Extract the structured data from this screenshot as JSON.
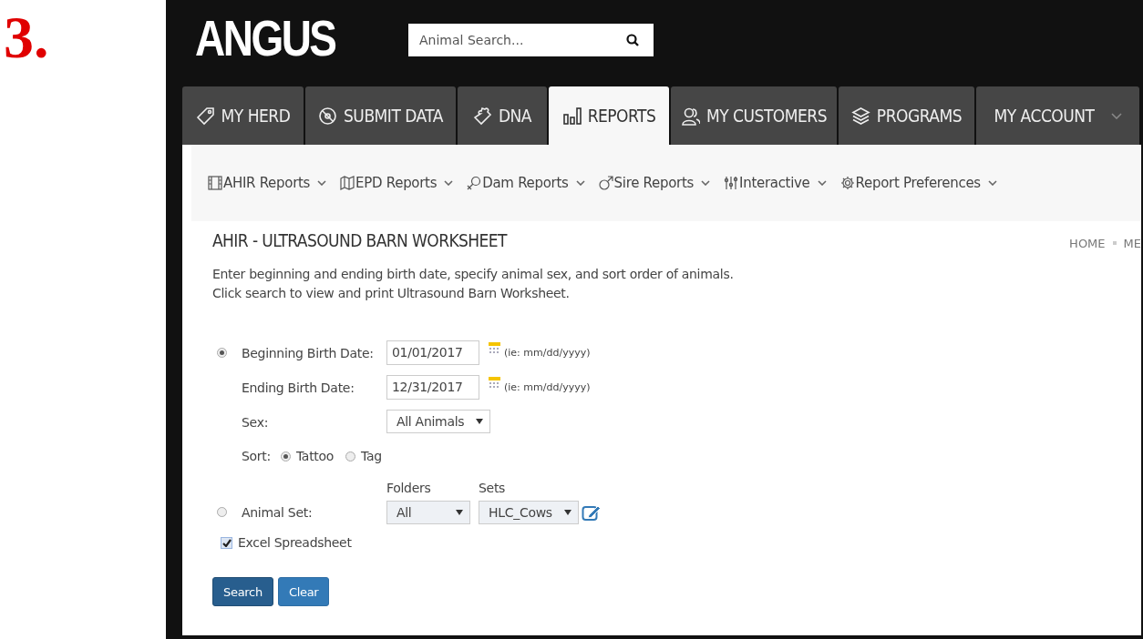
{
  "step_label": "3.",
  "header": {
    "logo": "ANGUS",
    "search": {
      "placeholder": "Animal Search..."
    }
  },
  "tabs": [
    {
      "label": "MY HERD",
      "kind": "link",
      "selected": false
    },
    {
      "label": "SUBMIT DATA",
      "kind": "link",
      "selected": false
    },
    {
      "label": "DNA",
      "kind": "link",
      "selected": false
    },
    {
      "label": "REPORTS",
      "kind": "link",
      "selected": true
    },
    {
      "label": "MY CUSTOMERS",
      "kind": "link",
      "selected": false
    },
    {
      "label": "PROGRAMS",
      "kind": "link",
      "selected": false
    },
    {
      "label": "MY ACCOUNT",
      "kind": "dropdown",
      "selected": false
    }
  ],
  "subnav": [
    {
      "label": "AHIR Reports"
    },
    {
      "label": "EPD Reports"
    },
    {
      "label": "Dam Reports"
    },
    {
      "label": "Sire Reports"
    },
    {
      "label": "Interactive"
    },
    {
      "label": "Report Preferences"
    }
  ],
  "page": {
    "title": "AHIR - ULTRASOUND BARN WORKSHEET",
    "breadcrumb": [
      "HOME",
      "ME"
    ],
    "intro": [
      "Enter beginning and ending birth date, specify animal sex, and sort order of animals.",
      "Click search to view and print Ultrasound Barn Worksheet."
    ]
  },
  "form": {
    "date_range": {
      "selected": true,
      "fields": [
        {
          "label": "Beginning Birth Date:",
          "value": "01/01/2017",
          "hint": "(ie: mm/dd/yyyy)"
        },
        {
          "label": "Ending Birth Date:",
          "value": "12/31/2017",
          "hint": "(ie: mm/dd/yyyy)"
        }
      ]
    },
    "sex": {
      "label": "Sex:",
      "value": "All Animals"
    },
    "sort": {
      "label": "Sort:",
      "options": [
        {
          "label": "Tattoo",
          "selected": true
        },
        {
          "label": "Tag",
          "selected": false
        }
      ]
    },
    "animal_set": {
      "selected": false,
      "disabled": true,
      "label": "Animal Set:",
      "folders": {
        "label": "Folders",
        "value": "All"
      },
      "sets": {
        "label": "Sets",
        "value": "HLC_Cows"
      }
    },
    "excel": {
      "label": "Excel Spreadsheet",
      "checked": true
    },
    "buttons": [
      {
        "label": "Search",
        "kind": "primary"
      },
      {
        "label": "Clear",
        "kind": "secondary"
      }
    ]
  }
}
